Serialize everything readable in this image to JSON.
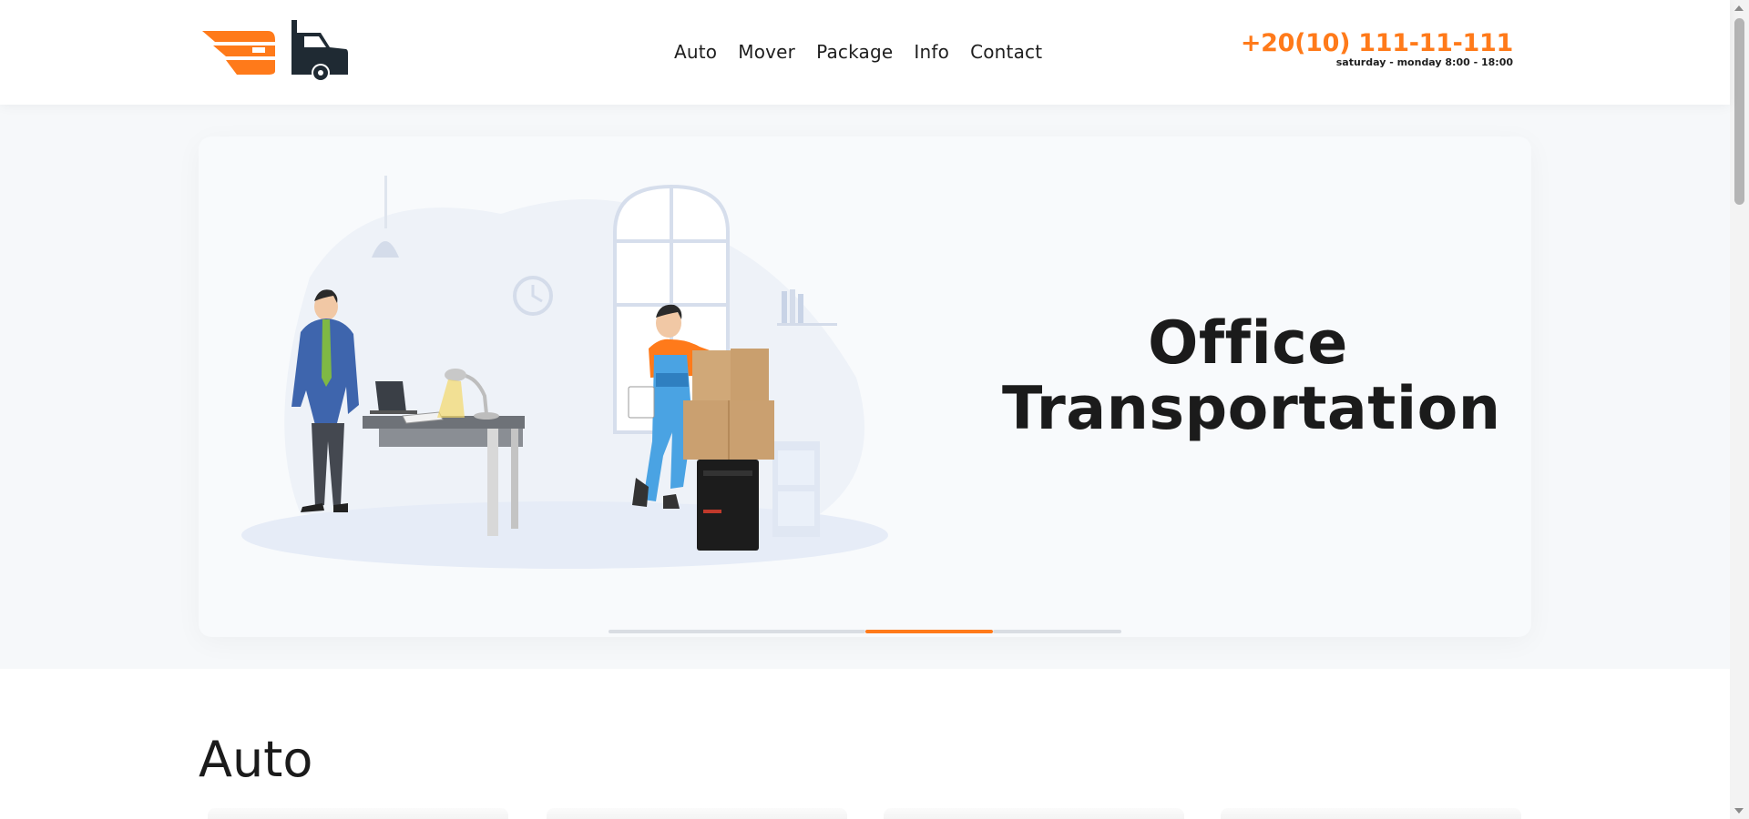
{
  "header": {
    "nav": [
      "Auto",
      "Mover",
      "Package",
      "Info",
      "Contact"
    ],
    "phone": "+20(10) 111-11-111",
    "hours": "saturday - monday 8:00 - 18:00"
  },
  "hero": {
    "title_line1": "Office",
    "title_line2": "Transportation",
    "slider": {
      "slides": 4,
      "active_index": 2
    }
  },
  "section": {
    "title": "Auto"
  },
  "colors": {
    "accent": "#ff7a1a",
    "dark": "#1e1e1e",
    "hero_bg": "#f6f8fa"
  },
  "icons": [
    "truck-logo-icon"
  ]
}
